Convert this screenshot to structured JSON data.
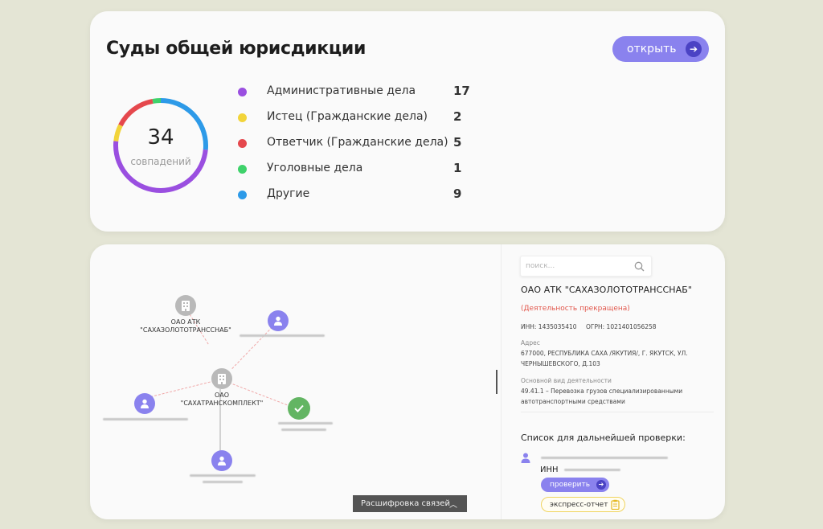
{
  "courts": {
    "title": "Суды общей юрисдикции",
    "open_label": "открыть",
    "total": "34",
    "total_label": "совпадений",
    "categories": [
      {
        "label": "Административные дела",
        "value": "17",
        "color": "#9a4fe0"
      },
      {
        "label": "Истец (Гражданские дела)",
        "value": "2",
        "color": "#f2d43a"
      },
      {
        "label": "Ответчик (Гражданские дела)",
        "value": "5",
        "color": "#e5484d"
      },
      {
        "label": "Уголовные дела",
        "value": "1",
        "color": "#3fd26b"
      },
      {
        "label": "Другие",
        "value": "9",
        "color": "#2d9ae8"
      }
    ]
  },
  "graph": {
    "node_company_1": "ОАО АТК\n\"САХАЗОЛОТОТРАНССНАБ\"",
    "node_company_2": "ОАО\n\"САХАТРАНСКОМПЛЕКТ\"",
    "decode_label": "Расшифровка связей"
  },
  "details": {
    "search_placeholder": "поиск...",
    "company_name": "ОАО АТК \"САХАЗОЛОТОТРАНССНАБ\"",
    "status": "(Деятельность прекращена)",
    "inn": "ИНН: 1435035410",
    "ogrn": "ОГРН: 1021401056258",
    "address_label": "Адрес",
    "address": "677000, РЕСПУБЛИКА САХА /ЯКУТИЯ/, Г. ЯКУТСК, УЛ. ЧЕРНЫШЕВСКОГО, Д.103",
    "activity_label": "Основной вид деятельности",
    "activity": "49.41.1 – Перевозка грузов специализированными автотранспортными средствами",
    "list_title": "Список для дальнейшей проверки:",
    "inn_prefix": "ИНН",
    "verify_label": "проверить",
    "express_label": "экспресс-отчет"
  },
  "colors": {
    "accent": "#8a82ee",
    "accent_dark": "#4b43c4",
    "status_red": "#e2574c"
  }
}
